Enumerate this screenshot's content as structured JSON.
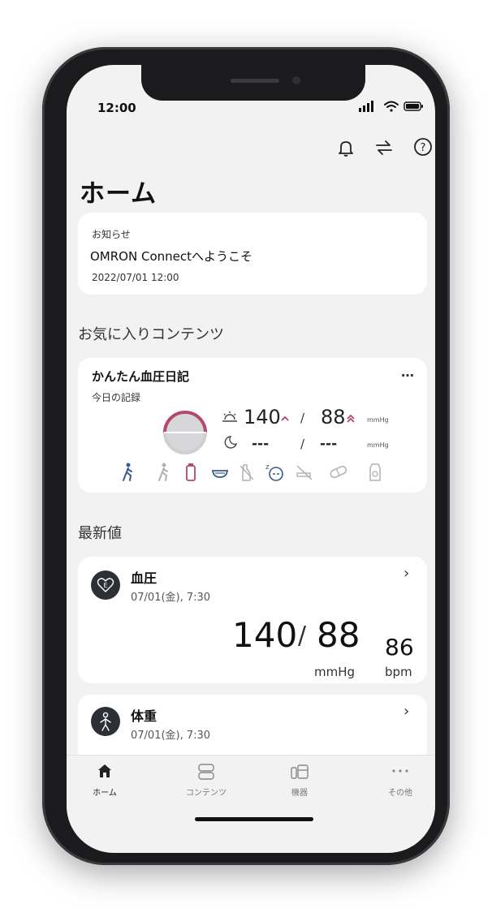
{
  "status_bar": {
    "time": "12:00"
  },
  "page": {
    "title": "ホーム"
  },
  "header_icons": [
    "bell-icon",
    "sync-icon",
    "help-icon"
  ],
  "notice": {
    "label": "お知らせ",
    "message": "OMRON Connectへようこそ",
    "datetime": "2022/07/01 12:00"
  },
  "favorites": {
    "section_title": "お気に入りコンテンツ",
    "card": {
      "title": "かんたん血圧日記",
      "more": "…",
      "subtitle": "今日の記録",
      "morning": {
        "systolic": "140",
        "separator": "/",
        "diastolic": "88",
        "unit": "mmHg"
      },
      "evening": {
        "systolic": "---",
        "separator": "/",
        "diastolic": "---",
        "unit": "mmHg"
      },
      "accent_color": "#b5476b",
      "activity_icons": [
        "walk-icon",
        "walk-light-icon",
        "bottle-icon",
        "bowl-icon",
        "no-alcohol-icon",
        "sleep-icon",
        "no-smoking-icon",
        "pill-icon",
        "salt-icon"
      ]
    }
  },
  "latest": {
    "section_title": "最新値",
    "blood_pressure": {
      "label": "血圧",
      "datetime": "07/01(金), 7:30",
      "systolic": "140",
      "separator": "/",
      "diastolic": "88",
      "unit": "mmHg",
      "pulse": "86",
      "pulse_unit": "bpm"
    },
    "weight": {
      "label": "体重",
      "datetime": "07/01(金), 7:30"
    }
  },
  "bottom_nav": [
    {
      "label": "ホーム",
      "icon": "home-icon",
      "active": true
    },
    {
      "label": "コンテンツ",
      "icon": "contents-icon",
      "active": false
    },
    {
      "label": "機器",
      "icon": "devices-icon",
      "active": false
    },
    {
      "label": "その他",
      "icon": "more-icon",
      "active": false
    }
  ]
}
